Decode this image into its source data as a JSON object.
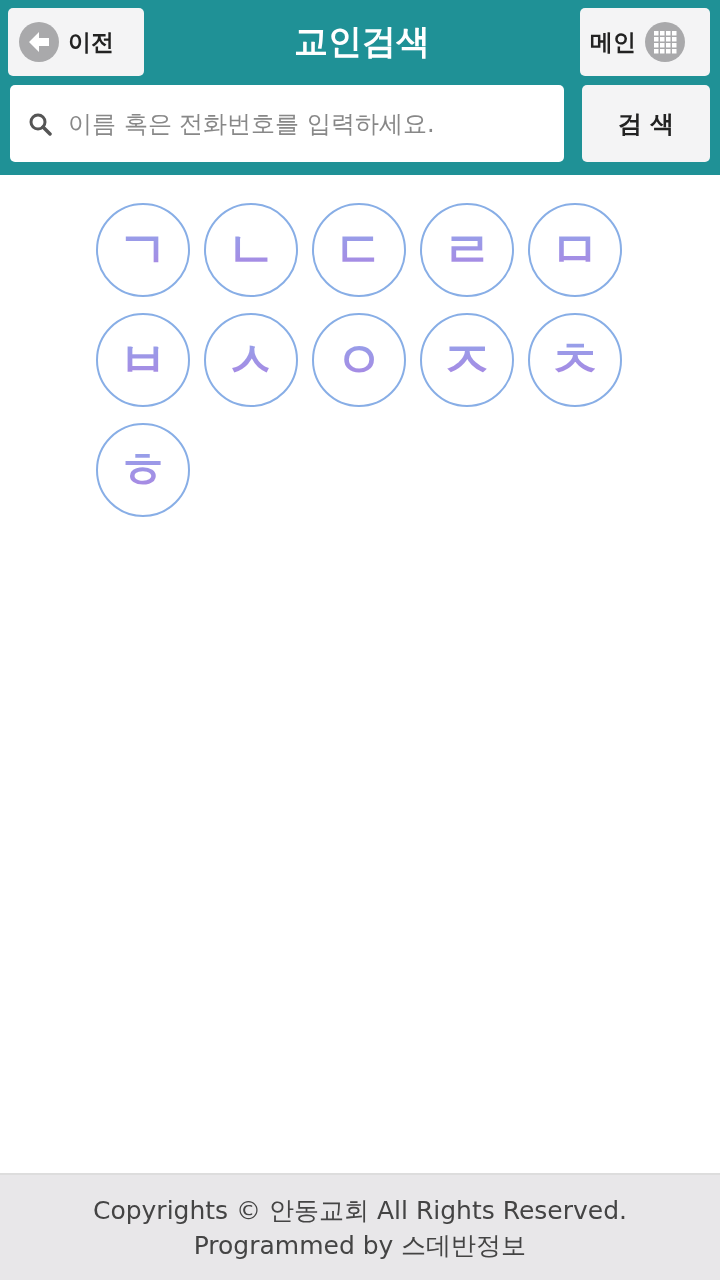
{
  "header": {
    "title": "교인검색",
    "back_button": {
      "label": "이전"
    },
    "main_button": {
      "label": "메인"
    }
  },
  "search": {
    "placeholder": "이름 혹은 전화번호를 입력하세요.",
    "button": "검 색"
  },
  "initials": [
    "ㄱ",
    "ㄴ",
    "ㄷ",
    "ㄹ",
    "ㅁ",
    "ㅂ",
    "ㅅ",
    "ㅇ",
    "ㅈ",
    "ㅊ",
    "ㅎ"
  ],
  "footer": {
    "lines": [
      "Copyrights © 안동교회 All Rights Reserved.",
      "Programmed by 스데반정보"
    ]
  }
}
